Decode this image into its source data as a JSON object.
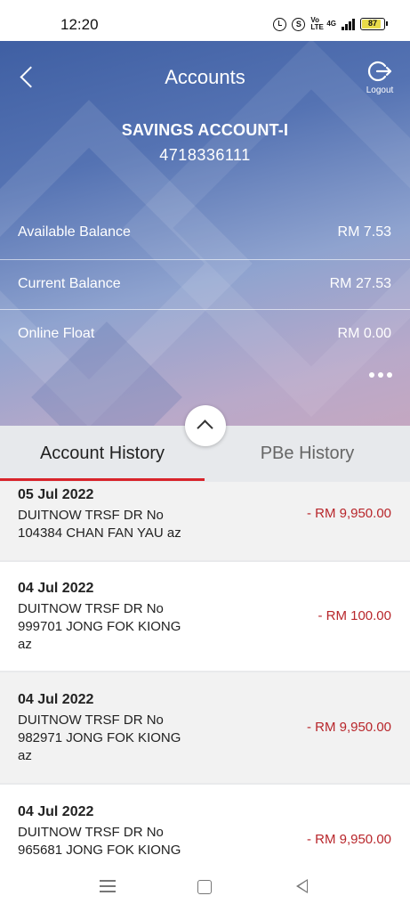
{
  "status_bar": {
    "time": "12:20",
    "icons": [
      "alarm-icon",
      "s-icon",
      "volte-icon",
      "4g-signal-icon",
      "battery-icon"
    ],
    "volte": "Vo LTE",
    "network": "4G",
    "battery": "87",
    "battery_level": 0.87
  },
  "header": {
    "title": "Accounts",
    "logout_label": "Logout"
  },
  "account": {
    "name": "SAVINGS ACCOUNT-I",
    "number": "4718336111"
  },
  "balances": [
    {
      "label": "Available Balance",
      "value": "RM 7.53"
    },
    {
      "label": "Current Balance",
      "value": "RM 27.53"
    },
    {
      "label": "Online Float",
      "value": "RM 0.00"
    }
  ],
  "tabs": [
    {
      "label": "Account History",
      "active": true
    },
    {
      "label": "PBe History",
      "active": false
    }
  ],
  "transactions": [
    {
      "date": "05 Jul 2022",
      "line1": "DUITNOW TRSF DR No",
      "line2": "104384 CHAN FAN YAU az",
      "line3": "",
      "amount": "- RM 9,950.00"
    },
    {
      "date": "04 Jul 2022",
      "line1": "DUITNOW TRSF DR No",
      "line2": "999701 JONG FOK KIONG",
      "line3": "az",
      "amount": "- RM 100.00"
    },
    {
      "date": "04 Jul 2022",
      "line1": "DUITNOW TRSF DR No",
      "line2": "982971 JONG FOK KIONG",
      "line3": "az",
      "amount": "- RM 9,950.00"
    },
    {
      "date": "04 Jul 2022",
      "line1": "DUITNOW TRSF DR No",
      "line2": "965681 JONG FOK KIONG",
      "line3": "",
      "amount": "- RM 9,950.00"
    }
  ],
  "colors": {
    "accent_red": "#d8232a",
    "amount_red": "#b8262b",
    "hero_blue": "#3f5fa3"
  }
}
